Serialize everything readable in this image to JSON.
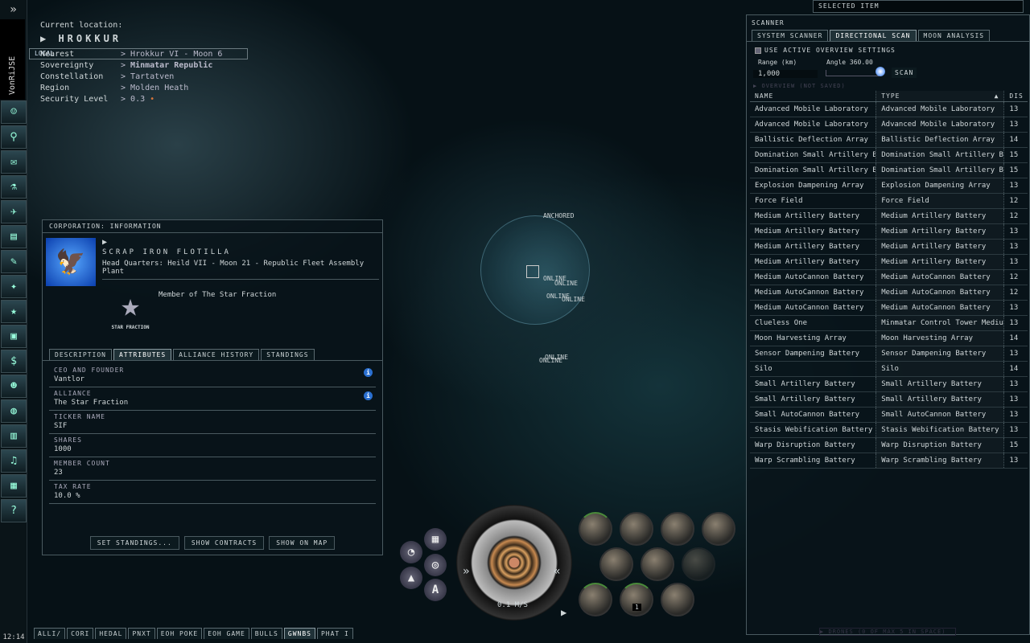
{
  "neocom": {
    "collapse_icon": "double-chevron-right",
    "character": "VonRiJSE",
    "clock": "12:14",
    "buttons": [
      "character-sheet",
      "people-places",
      "mail",
      "science-industry",
      "fleet",
      "market",
      "contracts",
      "map",
      "corporation",
      "assets",
      "wallet",
      "people",
      "browser",
      "journal",
      "audio",
      "calculator",
      "help"
    ]
  },
  "location": {
    "label": "Current location:",
    "system": "HROKKUR",
    "local_label": "LOCAL",
    "rows": [
      {
        "k": "Nearest",
        "v": "Hrokkur VI - Moon 6"
      },
      {
        "k": "Sovereignty",
        "v": "Minmatar Republic"
      },
      {
        "k": "Constellation",
        "v": "Tartatven"
      },
      {
        "k": "Region",
        "v": "Molden Heath"
      },
      {
        "k": "Security Level",
        "v": "0.3"
      }
    ],
    "security_color": "#d8763a"
  },
  "corp": {
    "title": "CORPORATION: INFORMATION",
    "name": "SCRAP IRON FLOTILLA",
    "hq": "Head Quarters: Heild VII - Moon 21 - Republic Fleet Assembly Plant",
    "member_of": "Member of The Star Fraction",
    "alliance_logo_text": "STAR FRACTION",
    "tabs": [
      "DESCRIPTION",
      "ATTRIBUTES",
      "ALLIANCE HISTORY",
      "STANDINGS"
    ],
    "active_tab": "ATTRIBUTES",
    "attributes": [
      {
        "label": "CEO AND FOUNDER",
        "value": "Vantlor",
        "info": true
      },
      {
        "label": "ALLIANCE",
        "value": "The Star Fraction",
        "info": true
      },
      {
        "label": "TICKER NAME",
        "value": "SIF"
      },
      {
        "label": "SHARES",
        "value": "1000"
      },
      {
        "label": "MEMBER COUNT",
        "value": "23"
      },
      {
        "label": "TAX RATE",
        "value": "10.0 %"
      }
    ],
    "buttons": [
      "SET STANDINGS...",
      "SHOW CONTRACTS",
      "SHOW ON MAP"
    ]
  },
  "space": {
    "labels": [
      "ANCHORED",
      "ONLINE",
      "ONLINE",
      "ONLINE",
      "ONLINE",
      "ONLINE",
      "ONLINE"
    ]
  },
  "hud": {
    "speed": "0.1 M/S",
    "charge_count": "1"
  },
  "selected_item": {
    "title": "SELECTED ITEM"
  },
  "scanner": {
    "title": "SCANNER",
    "tabs": [
      "SYSTEM SCANNER",
      "DIRECTIONAL SCAN",
      "MOON ANALYSIS"
    ],
    "active_tab": "DIRECTIONAL SCAN",
    "use_overview_label": "USE ACTIVE OVERVIEW SETTINGS",
    "use_overview_checked": false,
    "range_label": "Range (km)",
    "range_value": "1,000",
    "angle_label": "Angle 360.00",
    "scan_button": "SCAN",
    "overview_label": "OVERVIEW (NOT SAVED)",
    "columns": [
      "NAME",
      "TYPE",
      "DIS"
    ],
    "sort_column": "TYPE",
    "rows": [
      [
        "Advanced Mobile Laboratory",
        "Advanced Mobile Laboratory",
        "13"
      ],
      [
        "Advanced Mobile Laboratory",
        "Advanced Mobile Laboratory",
        "13"
      ],
      [
        "Ballistic Deflection Array",
        "Ballistic Deflection Array",
        "14"
      ],
      [
        "Domination Small Artillery Battery",
        "Domination Small Artillery Battery",
        "15"
      ],
      [
        "Domination Small Artillery Battery",
        "Domination Small Artillery Battery",
        "15"
      ],
      [
        "Explosion Dampening Array",
        "Explosion Dampening Array",
        "13"
      ],
      [
        "Force Field",
        "Force Field",
        "12"
      ],
      [
        "Medium Artillery Battery",
        "Medium Artillery Battery",
        "12"
      ],
      [
        "Medium Artillery Battery",
        "Medium Artillery Battery",
        "13"
      ],
      [
        "Medium Artillery Battery",
        "Medium Artillery Battery",
        "13"
      ],
      [
        "Medium Artillery Battery",
        "Medium Artillery Battery",
        "13"
      ],
      [
        "Medium AutoCannon Battery",
        "Medium AutoCannon Battery",
        "12"
      ],
      [
        "Medium AutoCannon Battery",
        "Medium AutoCannon Battery",
        "12"
      ],
      [
        "Medium AutoCannon Battery",
        "Medium AutoCannon Battery",
        "13"
      ],
      [
        "Clueless One",
        "Minmatar Control Tower Medium",
        "13"
      ],
      [
        "Moon Harvesting Array",
        "Moon Harvesting Array",
        "14"
      ],
      [
        "Sensor Dampening Battery",
        "Sensor Dampening Battery",
        "13"
      ],
      [
        "Silo",
        "Silo",
        "14"
      ],
      [
        "Small Artillery Battery",
        "Small Artillery Battery",
        "13"
      ],
      [
        "Small Artillery Battery",
        "Small Artillery Battery",
        "13"
      ],
      [
        "Small AutoCannon Battery",
        "Small AutoCannon Battery",
        "13"
      ],
      [
        "Stasis Webification Battery",
        "Stasis Webification Battery",
        "13"
      ],
      [
        "Warp Disruption Battery",
        "Warp Disruption Battery",
        "15"
      ],
      [
        "Warp Scrambling Battery",
        "Warp Scrambling Battery",
        "13"
      ]
    ]
  },
  "drones": {
    "label": "DRONES (0 OF MAX 5 IN SPACE)"
  },
  "chat_tabs": [
    "ALLI/",
    "CORI",
    "HEDAL",
    "PNXT",
    "EOH POKE",
    "EOH GAME",
    "BULLS",
    "GWNBS",
    "PHAT I"
  ],
  "active_chat_tab": "GWNBS"
}
